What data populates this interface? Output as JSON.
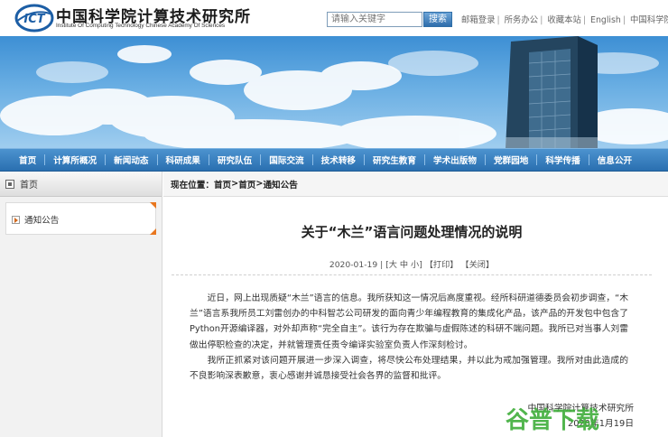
{
  "header": {
    "logo_cn": "中国科学院计算技术研究所",
    "logo_en": "Institute Of Computing Technology Chinese Academy Of Sciences",
    "search_placeholder": "请输入关键字",
    "search_button": "搜索",
    "links": [
      "邮箱登录",
      "所务办公",
      "收藏本站",
      "English",
      "中国科学院"
    ]
  },
  "nav": {
    "items": [
      "首页",
      "计算所概况",
      "新闻动态",
      "科研成果",
      "研究队伍",
      "国际交流",
      "技术转移",
      "研究生教育",
      "学术出版物",
      "党群园地",
      "科学传播",
      "信息公开"
    ]
  },
  "sidebar": {
    "heading": "首页",
    "items": [
      "通知公告"
    ]
  },
  "breadcrumb": {
    "label": "现在位置：",
    "path": [
      "首页",
      "首页",
      "通知公告"
    ],
    "sep": " > "
  },
  "article": {
    "title": "关于“木兰”语言问题处理情况的说明",
    "date": "2020-01-19",
    "font_size_label": "大 中 小",
    "print_label": "【打印】",
    "close_label": "【关闭】",
    "paragraphs": [
      "近日，网上出现质疑“木兰”语言的信息。我所获知这一情况后高度重视。经所科研道德委员会初步调查，“木兰”语言系我所员工刘雷创办的中科智芯公司研发的面向青少年编程教育的集成化产品，该产品的开发包中包含了Python开源编译器，对外却声称“完全自主”。该行为存在欺骗与虚假陈述的科研不端问题。我所已对当事人刘雷做出停职检查的决定，并就管理责任责令编译实验室负责人作深刻检讨。",
      "我所正抓紧对该问题开展进一步深入调查，将尽快公布处理结果，并以此为戒加强管理。我所对由此造成的不良影响深表歉意，衷心感谢并诚恳接受社会各界的监督和批评。"
    ],
    "signature": "中国科学院计算技术研究所",
    "signature_date": "2020年1月19日"
  },
  "watermark": "谷普下载",
  "colors": {
    "nav_blue": "#2a6fb0",
    "accent_orange": "#e8761f",
    "watermark_green": "#3fae3a"
  }
}
